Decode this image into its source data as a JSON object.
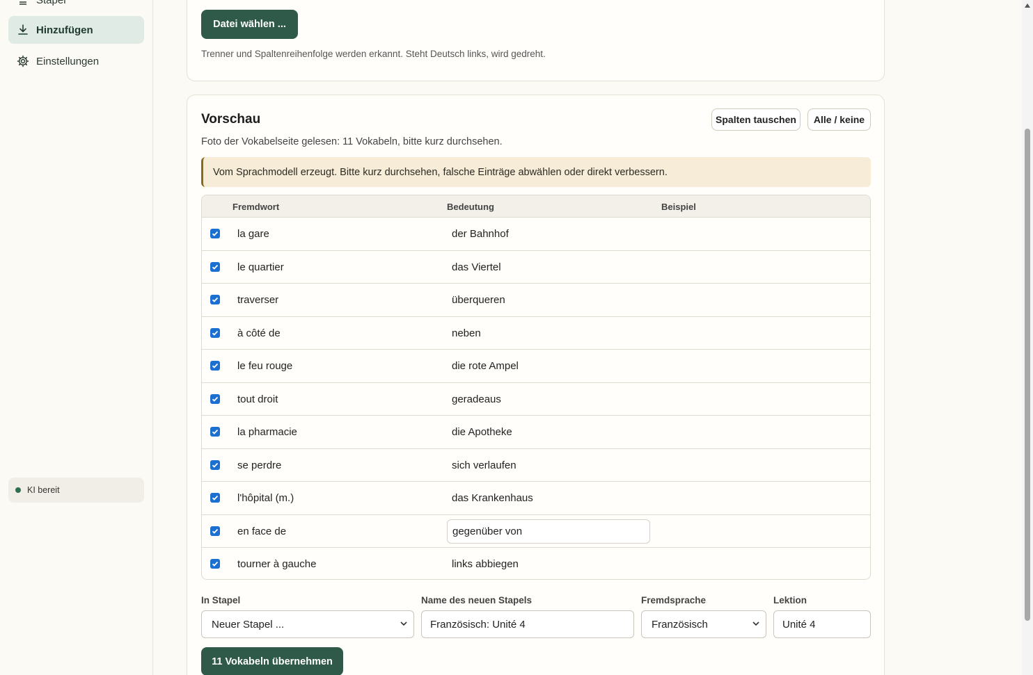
{
  "sidebar": {
    "items": [
      {
        "label": "Stapel",
        "icon": "stack-icon",
        "active": false
      },
      {
        "label": "Hinzufügen",
        "icon": "download-icon",
        "active": true
      },
      {
        "label": "Einstellungen",
        "icon": "gear-icon",
        "active": false
      }
    ],
    "status": {
      "label": "KI bereit",
      "color": "#2f6e4e"
    }
  },
  "import_card": {
    "file_button": "Datei wählen ...",
    "hint": "Trenner und Spaltenreihenfolge werden erkannt. Steht Deutsch links, wird gedreht."
  },
  "preview": {
    "title": "Vorschau",
    "subtitle": "Foto der Vokabelseite gelesen: 11 Vokabeln, bitte kurz durchsehen.",
    "swap_button": "Spalten tauschen",
    "toggle_all_button": "Alle / keine",
    "notice": "Vom Sprachmodell erzeugt. Bitte kurz durchsehen, falsche Einträge abwählen oder direkt verbessern.",
    "columns": [
      "Fremdwort",
      "Bedeutung",
      "Beispiel"
    ],
    "rows": [
      {
        "checked": true,
        "fremdwort": "la gare",
        "bedeutung": "der Bahnhof",
        "beispiel": ""
      },
      {
        "checked": true,
        "fremdwort": "le quartier",
        "bedeutung": "das Viertel",
        "beispiel": ""
      },
      {
        "checked": true,
        "fremdwort": "traverser",
        "bedeutung": "überqueren",
        "beispiel": ""
      },
      {
        "checked": true,
        "fremdwort": "à côté de",
        "bedeutung": "neben",
        "beispiel": ""
      },
      {
        "checked": true,
        "fremdwort": "le feu rouge",
        "bedeutung": "die rote Ampel",
        "beispiel": ""
      },
      {
        "checked": true,
        "fremdwort": "tout droit",
        "bedeutung": "geradeaus",
        "beispiel": ""
      },
      {
        "checked": true,
        "fremdwort": "la pharmacie",
        "bedeutung": "die Apotheke",
        "beispiel": ""
      },
      {
        "checked": true,
        "fremdwort": "se perdre",
        "bedeutung": "sich verlaufen",
        "beispiel": ""
      },
      {
        "checked": true,
        "fremdwort": "l'hôpital (m.)",
        "bedeutung": "das Krankenhaus",
        "beispiel": ""
      },
      {
        "checked": true,
        "fremdwort": "en face de",
        "bedeutung": "gegenüber von",
        "beispiel": "",
        "editing": true
      },
      {
        "checked": true,
        "fremdwort": "tourner à gauche",
        "bedeutung": "links abbiegen",
        "beispiel": ""
      }
    ]
  },
  "form": {
    "stapel_label": "In Stapel",
    "stapel_value": "Neuer Stapel ...",
    "name_label": "Name des neuen Stapels",
    "name_value": "Französisch: Unité 4",
    "sprache_label": "Fremdsprache",
    "sprache_value": "Französisch",
    "lektion_label": "Lektion",
    "lektion_value": "Unité 4",
    "apply_button": "11 Vokabeln übernehmen"
  },
  "colors": {
    "primary": "#2f5a49",
    "checkbox": "#1a6fd1",
    "notice_bg": "#f6ecd8"
  }
}
